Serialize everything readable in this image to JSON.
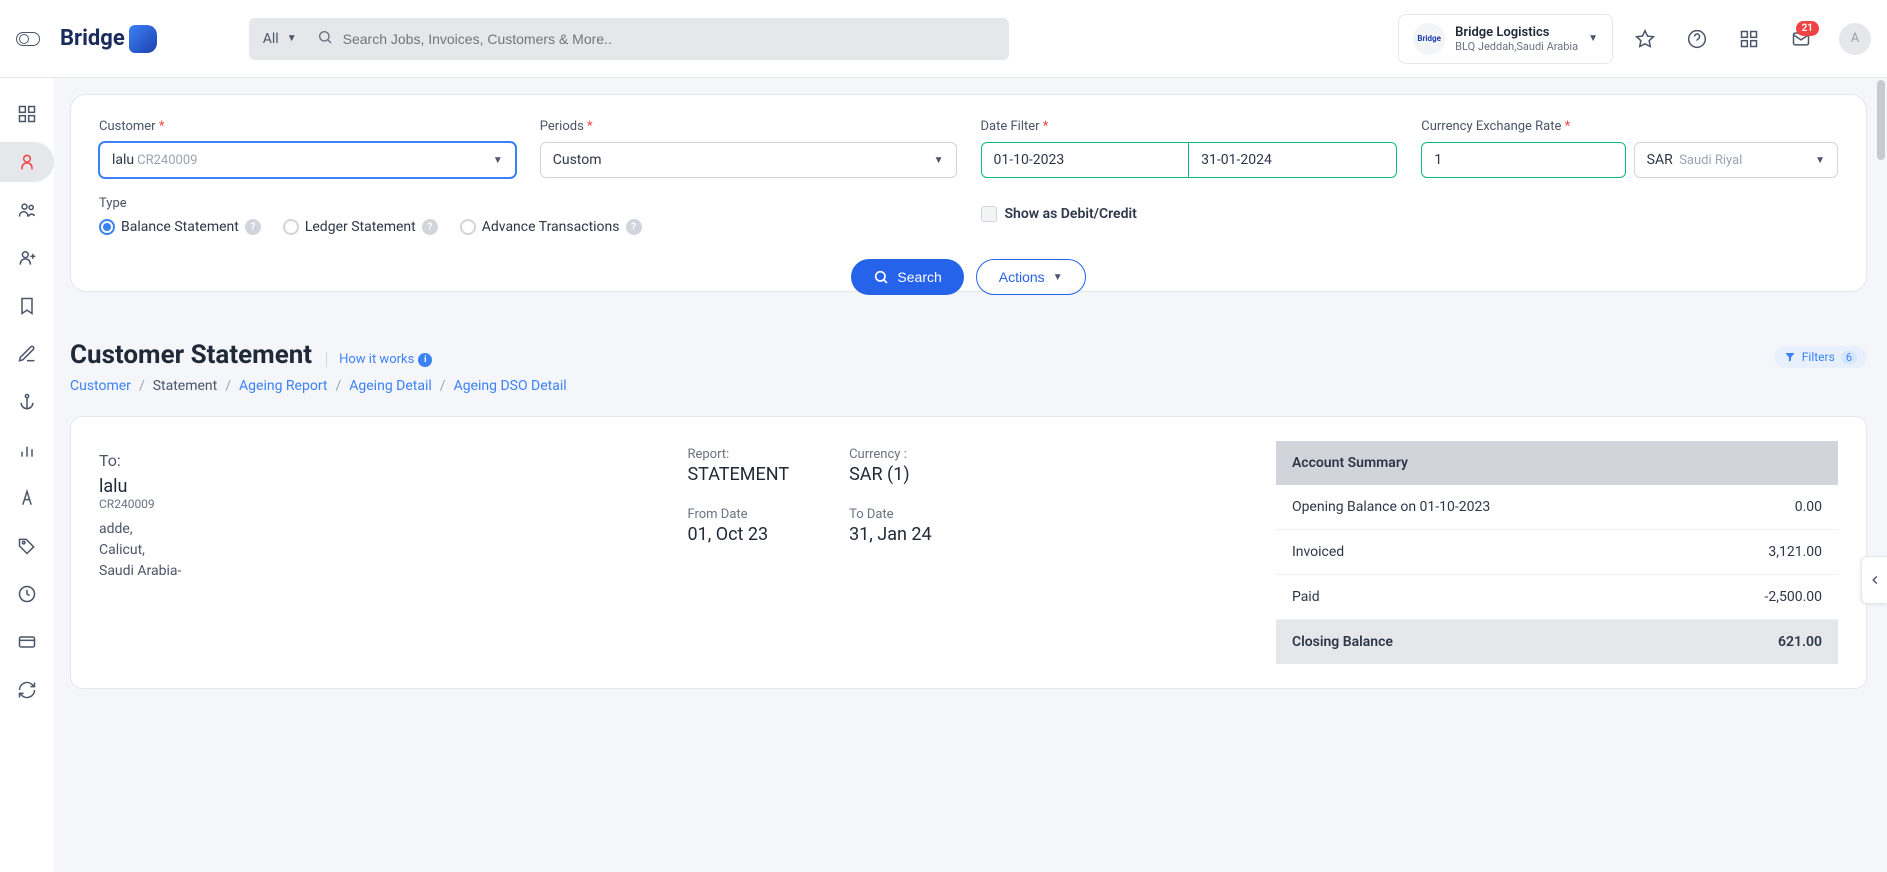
{
  "header": {
    "logo_text": "Bridge",
    "search_category": "All",
    "search_placeholder": "Search Jobs, Invoices, Customers & More..",
    "org_name": "Bridge Logistics",
    "org_sub": "BLQ Jeddah,Saudi Arabia",
    "mail_badge": "21",
    "avatar_initial": "A"
  },
  "filters": {
    "customer_label": "Customer",
    "customer_value": "lalu",
    "customer_code": "CR240009",
    "periods_label": "Periods",
    "periods_value": "Custom",
    "date_filter_label": "Date Filter",
    "date_from": "01-10-2023",
    "date_to": "31-01-2024",
    "currency_label": "Currency Exchange Rate",
    "currency_rate": "1",
    "currency_code": "SAR",
    "currency_name": "Saudi Riyal",
    "type_label": "Type",
    "type_options": [
      "Balance Statement",
      "Ledger Statement",
      "Advance Transactions"
    ],
    "show_debit_credit": "Show as Debit/Credit",
    "search_btn": "Search",
    "actions_btn": "Actions"
  },
  "title": {
    "heading": "Customer Statement",
    "how_it_works": "How it works",
    "filters_label": "Filters",
    "filters_count": "6"
  },
  "breadcrumb": [
    "Customer",
    "Statement",
    "Ageing Report",
    "Ageing Detail",
    "Ageing DSO Detail"
  ],
  "statement": {
    "to_label": "To:",
    "to_name": "lalu",
    "to_code": "CR240009",
    "addr1": "adde,",
    "addr2": "Calicut,",
    "addr3": "Saudi Arabia-",
    "report_label": "Report:",
    "report_value": "STATEMENT",
    "from_label": "From Date",
    "from_value": "01, Oct 23",
    "currency_label": "Currency :",
    "currency_value": "SAR (1)",
    "to_date_label": "To Date",
    "to_date_value": "31, Jan 24"
  },
  "summary": {
    "heading": "Account Summary",
    "rows": [
      {
        "label": "Opening Balance on 01-10-2023",
        "value": "0.00"
      },
      {
        "label": "Invoiced",
        "value": "3,121.00"
      },
      {
        "label": "Paid",
        "value": "-2,500.00"
      }
    ],
    "closing_label": "Closing Balance",
    "closing_value": "621.00"
  }
}
